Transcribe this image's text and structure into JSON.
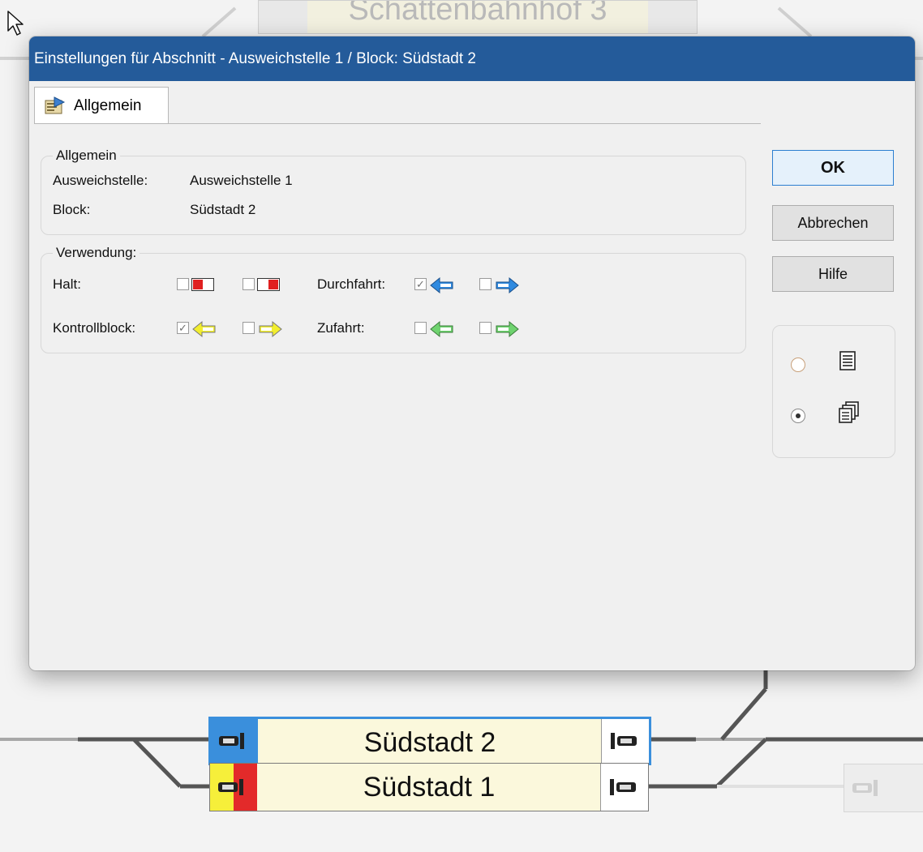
{
  "background": {
    "top_block": {
      "label": "Schattenbahnhof 3"
    },
    "blocks": [
      {
        "label": "Südstadt 2"
      },
      {
        "label": "Südstadt 1"
      }
    ]
  },
  "dialog": {
    "title": "Einstellungen für Abschnitt - Ausweichstelle 1 / Block: Südstadt 2",
    "tabs": [
      {
        "label": "Allgemein",
        "icon": "properties-icon"
      }
    ],
    "general_group": {
      "legend": "Allgemein",
      "ausweichstelle_label": "Ausweichstelle:",
      "ausweichstelle_value": "Ausweichstelle 1",
      "block_label": "Block:",
      "block_value": "Südstadt 2"
    },
    "usage_group": {
      "legend": "Verwendung:",
      "halt_label": "Halt:",
      "durchfahrt_label": "Durchfahrt:",
      "kontrollblock_label": "Kontrollblock:",
      "zufahrt_label": "Zufahrt:",
      "halt_left_checked": false,
      "halt_right_checked": false,
      "durchfahrt_left_checked": true,
      "durchfahrt_right_checked": false,
      "kontrollblock_left_checked": true,
      "kontrollblock_right_checked": false,
      "zufahrt_left_checked": false,
      "zufahrt_right_checked": false
    },
    "buttons": {
      "ok": "OK",
      "cancel": "Abbrechen",
      "help": "Hilfe"
    },
    "view_mode": {
      "options": [
        {
          "icon": "single-page-icon",
          "selected": false
        },
        {
          "icon": "multi-page-icon",
          "selected": true
        }
      ]
    }
  },
  "colors": {
    "titlebar": "#245b9a",
    "blue_arrow": "#2f8ae0",
    "yellow_arrow": "#f2ee2e",
    "green_arrow": "#6fd36f",
    "halt_red": "#e02020",
    "selected_block_border": "#3a8fdc"
  }
}
